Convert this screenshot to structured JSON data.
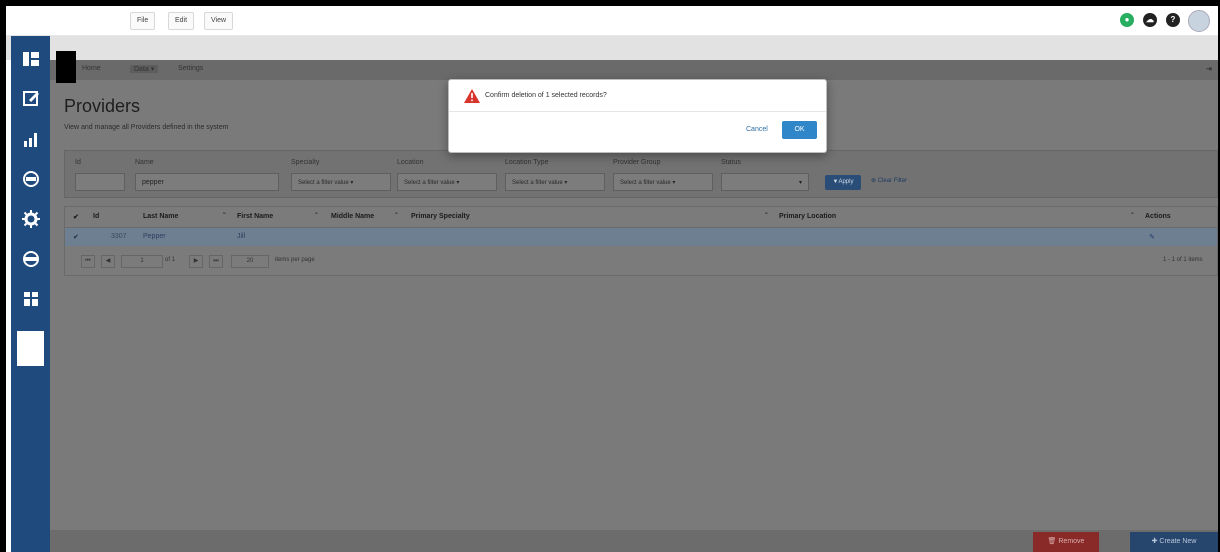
{
  "menu": {
    "file": "File",
    "edit": "Edit",
    "view": "View"
  },
  "top_icons": [
    {
      "name": "status-icon",
      "color": "#27ae60"
    },
    {
      "name": "cloud-icon",
      "color": "#222222"
    },
    {
      "name": "help-icon",
      "color": "#222222"
    },
    {
      "name": "user-avatar-icon",
      "color": "#c8d3e0"
    }
  ],
  "sidebar": {
    "items": [
      "dashboard-icon",
      "edit-icon",
      "chart-icon",
      "web-icon",
      "settings-icon",
      "sql-icon",
      "grid-icon",
      "blank-item"
    ]
  },
  "breadcrumb": {
    "home": "Home",
    "data": "Data ▾",
    "settings": "Settings"
  },
  "page": {
    "title": "Providers",
    "subtitle": "View and manage all Providers defined in the system"
  },
  "filters": {
    "id_label": "Id",
    "name_label": "Name",
    "name_value": "pepper",
    "specialty_label": "Specialty",
    "location_label": "Location",
    "location_type_label": "Location Type",
    "provider_group_label": "Provider Group",
    "status_label": "Status",
    "select_placeholder": "Select a filter value ▾",
    "apply_label": "▼Apply",
    "clear_label": "⊗ Clear Filter"
  },
  "grid": {
    "headers": {
      "id": "Id",
      "last_name": "Last Name",
      "first_name": "First Name",
      "middle_name": "Middle Name",
      "primary_specialty": "Primary Specialty",
      "primary_location": "Primary Location",
      "actions": "Actions"
    },
    "rows": [
      {
        "id": "3307",
        "last_name": "Pepper",
        "first_name": "Jill"
      }
    ],
    "pager": {
      "page": "1",
      "of": "of 1",
      "page_size": "20",
      "items_label": "items per page",
      "info": "1 - 1 of 1 items"
    }
  },
  "footer": {
    "remove_label": "🗑 Remove",
    "create_label": "✚ Create New"
  },
  "dialog": {
    "message": "Confirm deletion of 1 selected records?",
    "cancel_label": "Cancel",
    "ok_label": "OK"
  },
  "colors": {
    "sidebar": "#1f4a7e",
    "ok_button": "#2f86c8",
    "warning": "#d9342b"
  }
}
